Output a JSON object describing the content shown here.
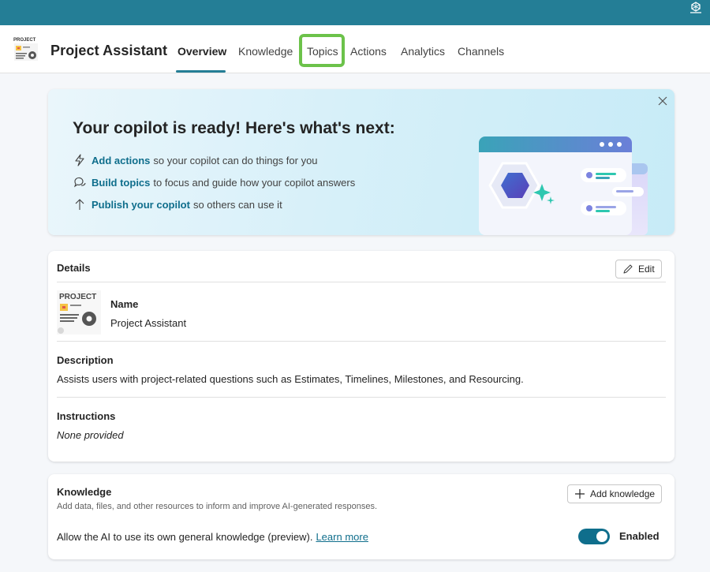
{
  "header": {
    "app_title": "Project Assistant",
    "logo_text": "PROJECT",
    "tabs": [
      {
        "label": "Overview",
        "active": true
      },
      {
        "label": "Knowledge",
        "active": false
      },
      {
        "label": "Topics",
        "active": false
      },
      {
        "label": "Actions",
        "active": false
      },
      {
        "label": "Analytics",
        "active": false
      },
      {
        "label": "Channels",
        "active": false
      }
    ]
  },
  "banner": {
    "title": "Your copilot is ready! Here's what's next:",
    "items": [
      {
        "icon": "lightning-icon",
        "link": "Add actions",
        "text": "so your copilot can do things for you"
      },
      {
        "icon": "chat-bubbles-icon",
        "link": "Build topics",
        "text": "to focus and guide how your copilot answers"
      },
      {
        "icon": "arrow-up-icon",
        "link": "Publish your copilot",
        "text": "so others can use it"
      }
    ]
  },
  "details": {
    "title": "Details",
    "edit_label": "Edit",
    "logo_text": "PROJECT",
    "name_label": "Name",
    "name_value": "Project Assistant",
    "description_label": "Description",
    "description_value": "Assists users with project-related questions such as Estimates, Timelines, Milestones, and Resourcing.",
    "instructions_label": "Instructions",
    "instructions_value": "None provided"
  },
  "knowledge": {
    "title": "Knowledge",
    "subtitle": "Add data, files, and other resources to inform and improve AI-generated responses.",
    "add_label": "Add knowledge",
    "ai_text": "Allow the AI to use its own general knowledge (preview).",
    "learn_more": "Learn more",
    "toggle_on": true,
    "toggle_label": "Enabled"
  },
  "colors": {
    "topbar": "#247e96",
    "accent": "#0f6e8c",
    "tab_highlight": "#6cc24a"
  }
}
